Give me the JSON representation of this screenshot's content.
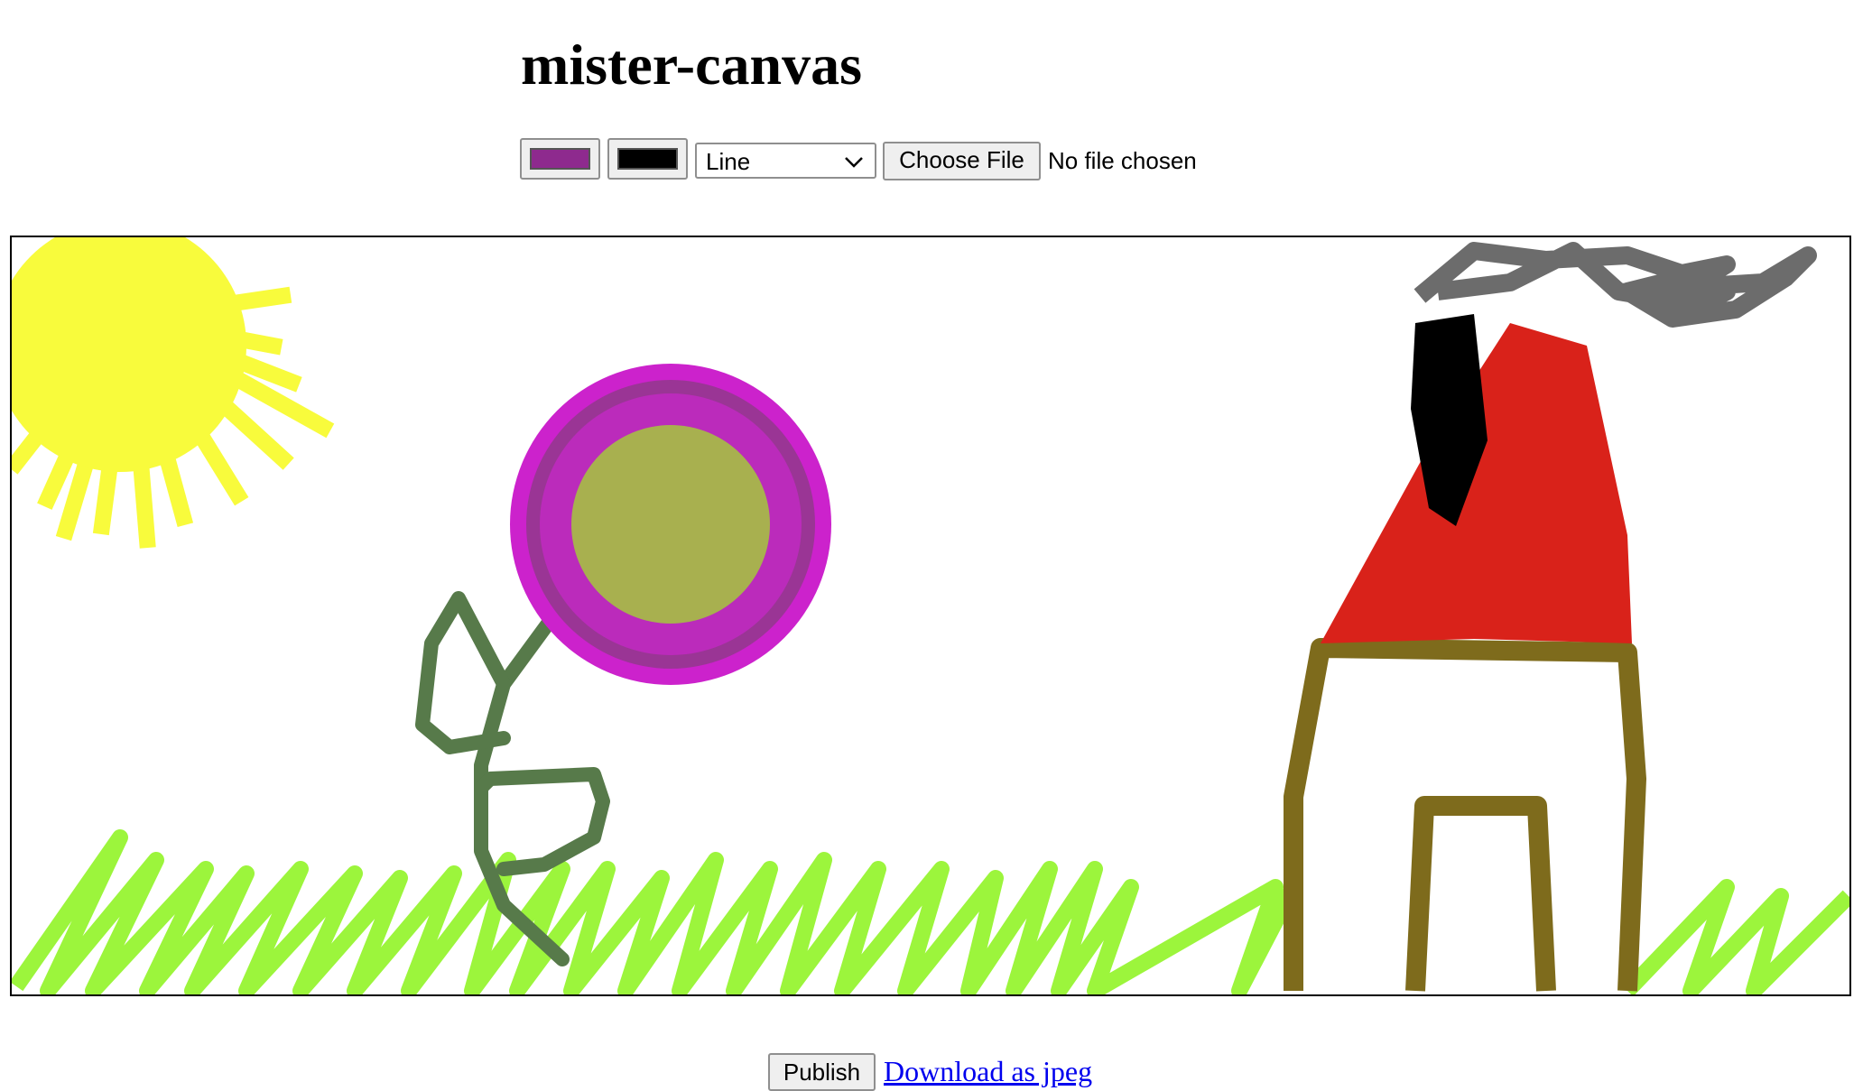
{
  "app": {
    "title": "mister-canvas"
  },
  "toolbar": {
    "stroke_color": "#8e2a8e",
    "fill_color": "#000000",
    "shape_selected": "Line",
    "file_button_label": "Choose File",
    "file_status": "No file chosen"
  },
  "canvas": {
    "background": "#ffffff"
  },
  "footer": {
    "publish_label": "Publish",
    "download_label": "Download as jpeg"
  },
  "icons": {
    "dropdown": "chevron-down-icon"
  }
}
